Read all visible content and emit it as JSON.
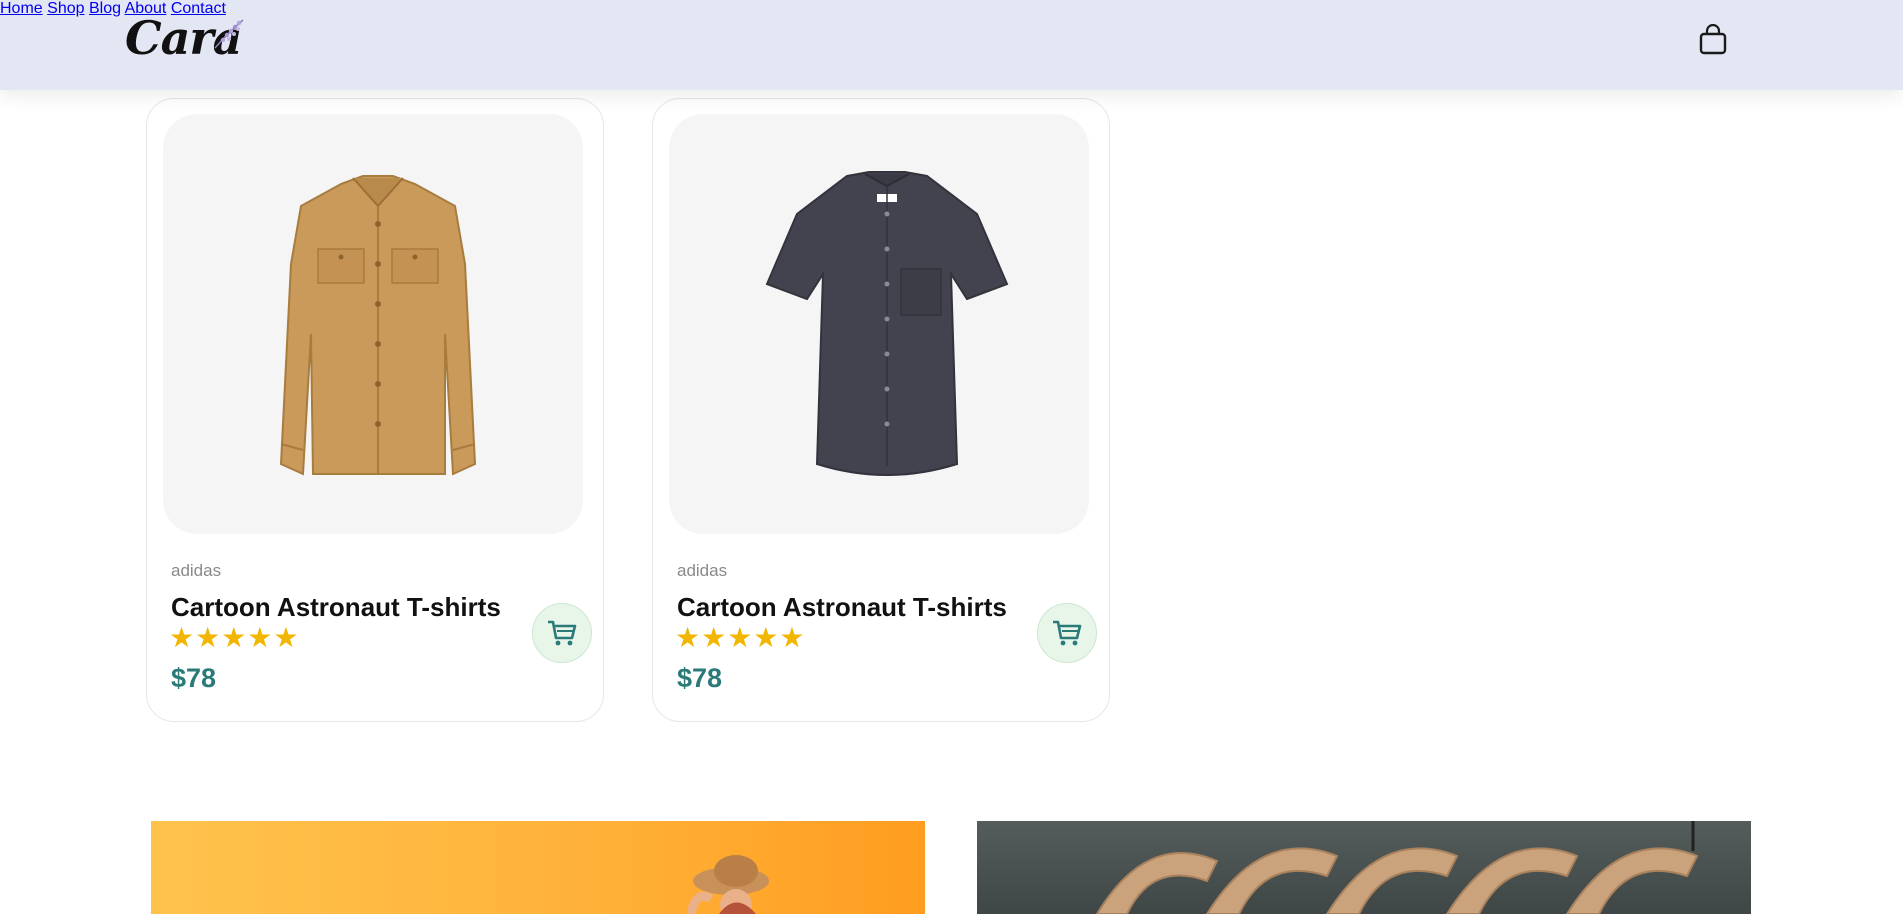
{
  "header": {
    "logo_text": "Cara",
    "nav": [
      "Home",
      "Shop",
      "Blog",
      "About",
      "Contact"
    ],
    "cart_icon": "shopping-bag-icon",
    "background_color": "#e3e6f3"
  },
  "products": [
    {
      "brand": "adidas",
      "name": "Cartoon Astronaut T-shirts",
      "stars": "★★★★★",
      "rating": 5,
      "price": "$78",
      "image": "tan-button-up-shirt",
      "cart_icon": "cart-icon"
    },
    {
      "brand": "adidas",
      "name": "Cartoon Astronaut T-shirts",
      "stars": "★★★★★",
      "rating": 5,
      "price": "$78",
      "image": "navy-short-sleeve-shirt",
      "cart_icon": "cart-icon"
    }
  ],
  "colors": {
    "price": "#2a7a78",
    "stars": "#f2b600",
    "cart_button_bg": "#e8f6ea"
  }
}
